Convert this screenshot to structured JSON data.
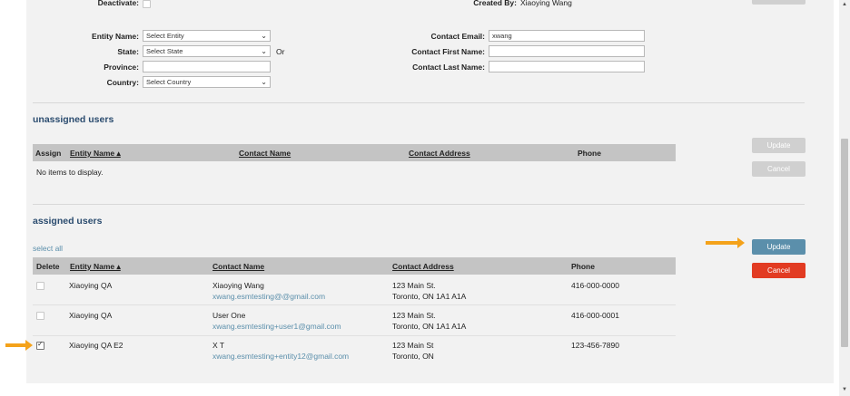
{
  "filters": {
    "deactivate_label": "Deactivate:",
    "created_by_label": "Created By:",
    "created_by_value": "Xiaoying Wang",
    "entity_name_label": "Entity Name:",
    "entity_name_value": "Select Entity",
    "state_label": "State:",
    "state_value": "Select State",
    "or_text": "Or",
    "province_label": "Province:",
    "province_value": "",
    "country_label": "Country:",
    "country_value": "Select Country",
    "contact_email_label": "Contact Email:",
    "contact_email_value": "xwang",
    "contact_first_name_label": "Contact First Name:",
    "contact_first_name_value": "",
    "contact_last_name_label": "Contact Last Name:",
    "contact_last_name_value": ""
  },
  "unassigned": {
    "title": "unassigned users",
    "columns": [
      "Assign",
      "Entity Name ▴",
      "Contact Name",
      "Contact Address",
      "Phone"
    ],
    "empty_message": "No items to display.",
    "update_label": "Update",
    "cancel_label": "Cancel"
  },
  "assigned": {
    "title": "assigned users",
    "select_all": "select all",
    "columns": [
      "Delete",
      "Entity Name ▴",
      "Contact Name",
      "Contact Address",
      "Phone"
    ],
    "update_label": "Update",
    "cancel_label": "Cancel",
    "rows": [
      {
        "checked": false,
        "entity": "Xiaoying QA",
        "contact_name": "Xiaoying Wang",
        "email": "xwang.esmtesting@@gmail.com",
        "address1": "123 Main St.",
        "address2": "Toronto, ON 1A1 A1A",
        "phone": "416-000-0000"
      },
      {
        "checked": false,
        "entity": "Xiaoying QA",
        "contact_name": "User One",
        "email": "xwang.esmtesting+user1@gmail.com",
        "address1": "123 Main St.",
        "address2": "Toronto, ON 1A1 A1A",
        "phone": "416-000-0001"
      },
      {
        "checked": true,
        "entity": "Xiaoying QA E2",
        "contact_name": "X T",
        "email": "xwang.esmtesting+entity12@gmail.com",
        "address1": "123 Main St",
        "address2": "Toronto, ON",
        "phone": "123-456-7890"
      }
    ]
  },
  "colors": {
    "accent": "#5b8fab",
    "danger": "#e23b22",
    "annotation_arrow": "#f4a21a",
    "section_title": "#2b4c6f"
  }
}
